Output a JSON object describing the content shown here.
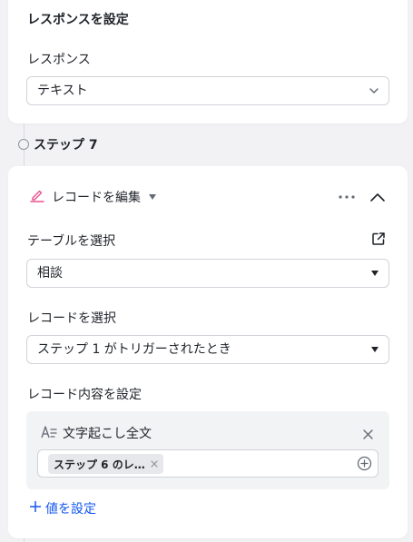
{
  "response_card": {
    "title": "レスポンスを設定",
    "response_label": "レスポンス",
    "response_value": "テキスト"
  },
  "step": {
    "label": "ステップ 7"
  },
  "action_card": {
    "title": "レコードを編集",
    "table_label": "テーブルを選択",
    "table_value": "相談",
    "record_label": "レコードを選択",
    "record_value": "ステップ 1 がトリガーされたとき",
    "content_label": "レコード内容を設定",
    "field": {
      "name": "文字起こし全文",
      "chip_text": "ステップ 6 のレ…"
    },
    "add_value_label": "値を設定"
  },
  "colors": {
    "accent": "#1456f0",
    "edit_icon": "#e8508f",
    "background": "#f2f2f4"
  },
  "icons": [
    "chevron-down-icon",
    "edit-icon",
    "caret-down-icon",
    "more-icon",
    "chevron-up-icon",
    "external-link-icon",
    "text-field-icon",
    "close-icon",
    "plus-circle-icon",
    "plus-icon"
  ]
}
